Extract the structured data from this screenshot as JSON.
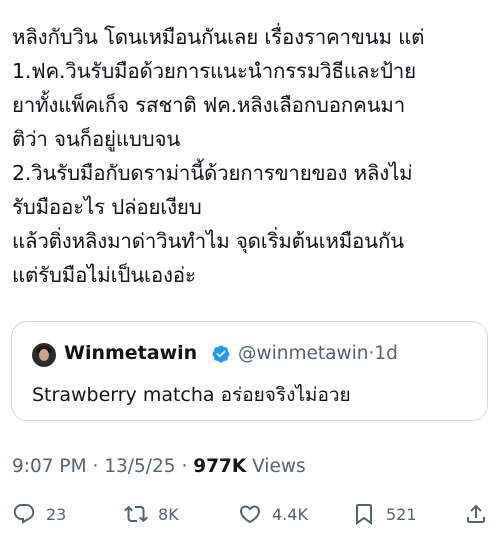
{
  "post": {
    "lines": [
      "หลิงกับวิน โดนเหมือนกันเลย เรื่องราคาขนม แต่",
      "1.ฟค.วินรับมือด้วยการแนะนำกรรมวิธีและป้าย",
      "ยาทั้งแพ็คเก็จ รสชาติ ฟค.หลิงเลือกบอกคนมา",
      "ติว่า จนก็อยู่แบบจน",
      "2.วินรับมือกับดราม่านี้ด้วยการขายของ หลิงไม่",
      "รับมืออะไร ปล่อยเงียบ",
      "แล้วติ่งหลิงมาด่าวินทำไม จุดเริ่มต้นเหมือนกัน",
      "แต่รับมือไม่เป็นเองอ่ะ"
    ]
  },
  "quote": {
    "name": "Winmetawin",
    "handle": "@winmetawin",
    "separator": "·",
    "age": "1d",
    "text": "Strawberry matcha อร่อยจริงไม่อวย",
    "verified_color": "#1d9bf0"
  },
  "meta": {
    "time": "9:07 PM",
    "dot1": "·",
    "date": "13/5/25",
    "dot2": "·",
    "views_count": "977K",
    "views_label": "Views"
  },
  "actions": {
    "replies": "23",
    "reposts": "8K",
    "likes": "4.4K",
    "bookmarks": "521"
  }
}
